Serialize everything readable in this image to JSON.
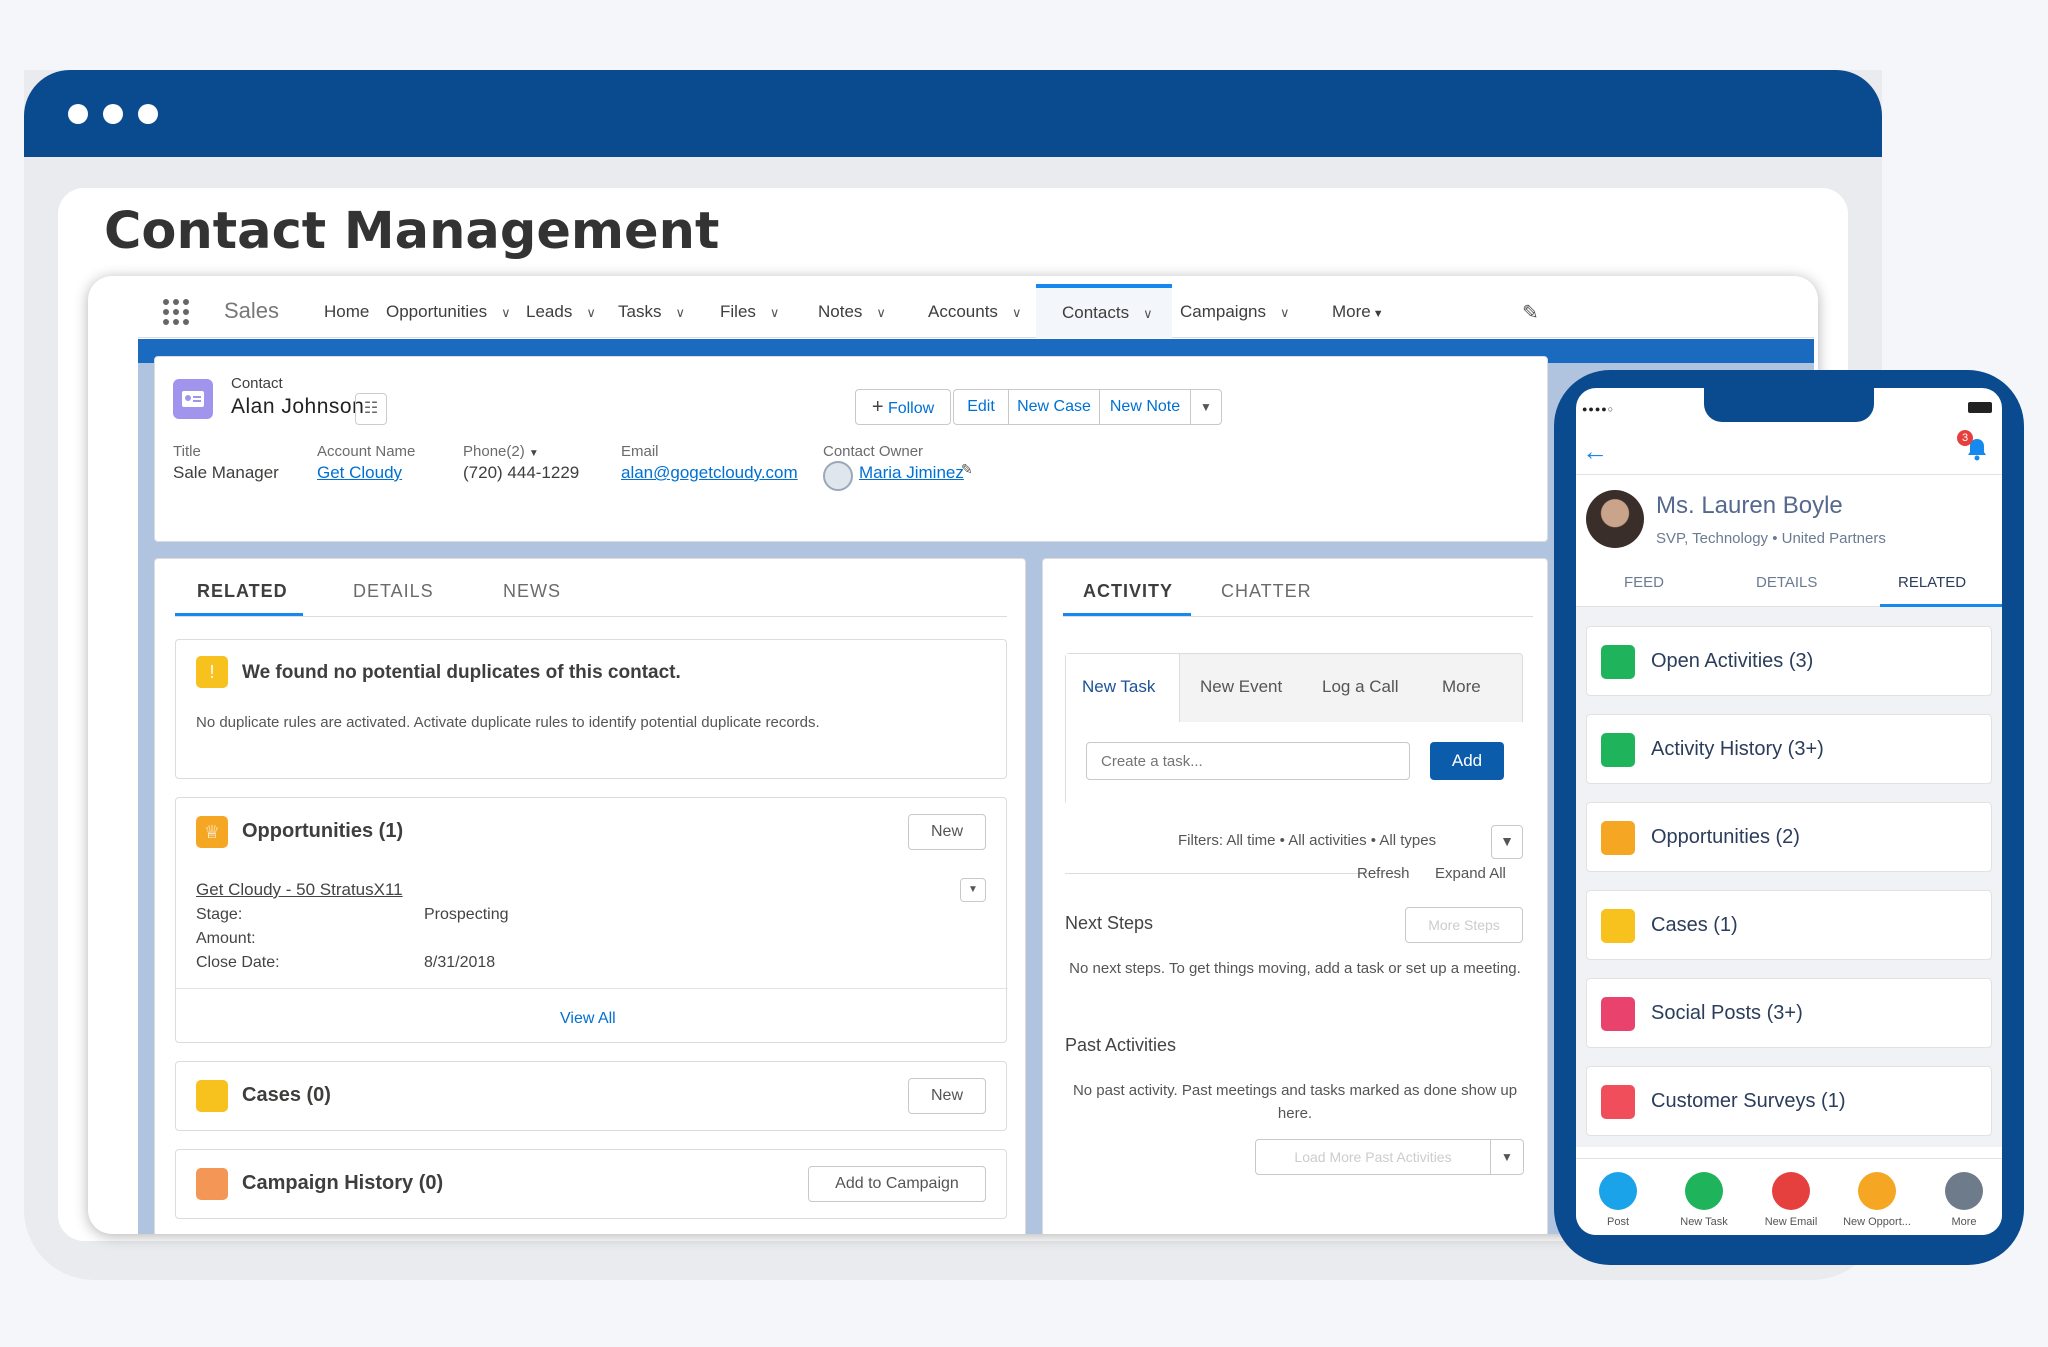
{
  "page": {
    "title": "Contact Management"
  },
  "nav": {
    "app_name": "Sales",
    "items": [
      "Home",
      "Opportunities",
      "Leads",
      "Tasks",
      "Files",
      "Notes",
      "Accounts",
      "Contacts",
      "Campaigns",
      "More"
    ],
    "active": "Contacts"
  },
  "contact": {
    "type_label": "Contact",
    "name": "Alan Johnson",
    "actions": {
      "follow": "Follow",
      "edit": "Edit",
      "new_case": "New Case",
      "new_note": "New Note"
    },
    "fields": {
      "title_label": "Title",
      "title_value": "Sale Manager",
      "account_label": "Account Name",
      "account_value": "Get Cloudy",
      "phone_label": "Phone(2)",
      "phone_value": "(720) 444-1229",
      "email_label": "Email",
      "email_value": "alan@gogetcloudy.com",
      "owner_label": "Contact Owner",
      "owner_value": "Maria Jiminez"
    }
  },
  "left": {
    "tabs": [
      "RELATED",
      "DETAILS",
      "NEWS"
    ],
    "dup_title": "We found no potential duplicates of this contact.",
    "dup_text": "No duplicate rules are activated. Activate duplicate rules to identify potential duplicate records.",
    "opps_title": "Opportunities (1)",
    "new_label": "New",
    "opp_link": "Get Cloudy - 50 StratusX11",
    "opp_stage_label": "Stage:",
    "opp_stage": "Prospecting",
    "opp_amount_label": "Amount:",
    "opp_close_label": "Close Date:",
    "opp_close": "8/31/2018",
    "view_all": "View All",
    "cases_title": "Cases (0)",
    "campaign_title": "Campaign History (0)",
    "add_campaign": "Add to Campaign"
  },
  "activity": {
    "tabs": [
      "ACTIVITY",
      "CHATTER"
    ],
    "subtabs": [
      "New Task",
      "New Event",
      "Log a Call",
      "More"
    ],
    "task_placeholder": "Create a task...",
    "add": "Add",
    "filters": "Filters: All time • All activities • All types",
    "refresh": "Refresh",
    "expand": "Expand All",
    "next_steps": "Next Steps",
    "more_steps": "More Steps",
    "no_next": "No next steps. To get things moving, add a task or set up a meeting.",
    "past": "Past Activities",
    "no_past": "No past activity. Past meetings and tasks marked as done show up here.",
    "load_more": "Load More Past Activities"
  },
  "mobile": {
    "badge": "3",
    "name": "Ms. Lauren Boyle",
    "subtitle": "SVP, Technology • United Partners",
    "tabs": [
      "FEED",
      "DETAILS",
      "RELATED"
    ],
    "related": [
      {
        "label": "Open Activities (3)",
        "color": "#1fb35b"
      },
      {
        "label": "Activity History (3+)",
        "color": "#1fb35b"
      },
      {
        "label": "Opportunities (2)",
        "color": "#f5a623"
      },
      {
        "label": "Cases (1)",
        "color": "#f7c11e"
      },
      {
        "label": "Social Posts (3+)",
        "color": "#e9426c"
      },
      {
        "label": "Customer Surveys (1)",
        "color": "#ef4e5a"
      }
    ],
    "actions": [
      {
        "label": "Post",
        "color": "#1aa3e8"
      },
      {
        "label": "New Task",
        "color": "#1fb35b"
      },
      {
        "label": "New Email",
        "color": "#e5403e"
      },
      {
        "label": "New Opport...",
        "color": "#f5a623"
      },
      {
        "label": "More",
        "color": "#6e7b8a"
      }
    ]
  }
}
